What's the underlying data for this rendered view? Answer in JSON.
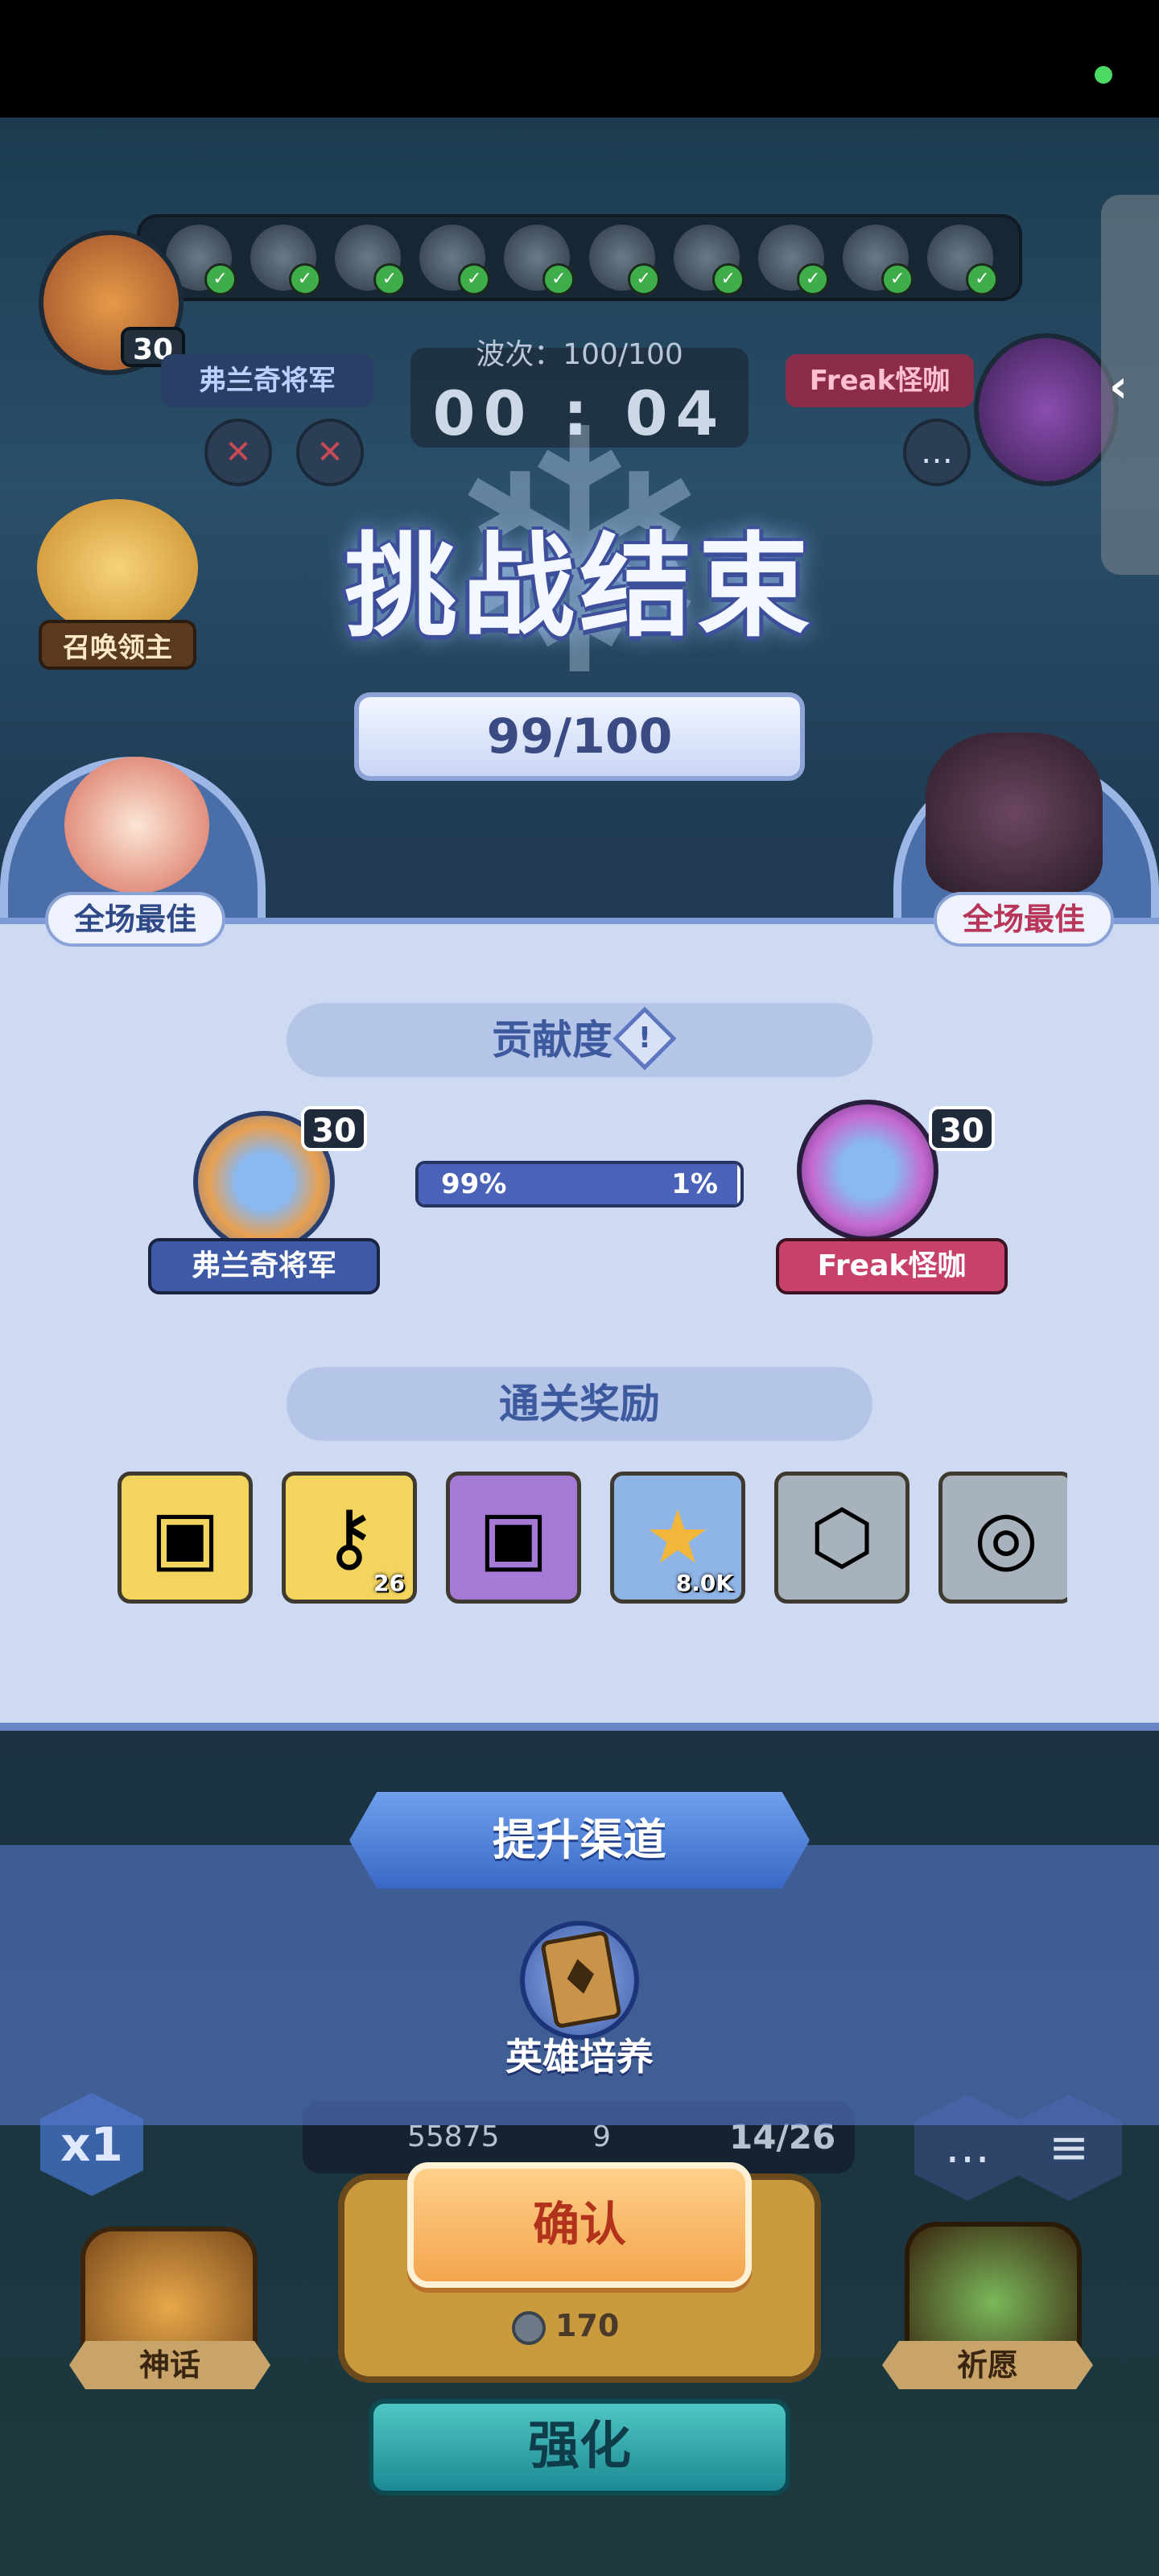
{
  "hud": {
    "left_player_name": "弗兰奇将军",
    "left_player_level": "30",
    "right_player_name": "Freak怪咖",
    "right_player_level": "30",
    "wave_text": "波次：100/100",
    "timer": "00 : 04",
    "summon_lord_label": "召唤领主"
  },
  "result": {
    "title": "挑战结束",
    "score": "99/100",
    "mvp_left": "全场最佳",
    "mvp_right": "全场最佳"
  },
  "contribution": {
    "header": "贡献度",
    "info_icon": "!",
    "left_name": "弗兰奇将军",
    "left_level": "30",
    "right_name": "Freak怪咖",
    "right_level": "30",
    "left_pct": "99%",
    "right_pct": "1%",
    "left_fraction": 0.99
  },
  "rewards": {
    "header": "通关奖励",
    "items": [
      {
        "icon": "gold-chest-icon",
        "qty": ""
      },
      {
        "icon": "gold-key-icon",
        "qty": "26"
      },
      {
        "icon": "purple-chest-icon",
        "qty": ""
      },
      {
        "icon": "gold-coin-icon",
        "qty": "8.0K"
      },
      {
        "icon": "hero-emblem-icon",
        "qty": ""
      },
      {
        "icon": "silver-emblem-icon",
        "qty": ""
      }
    ]
  },
  "channel": {
    "banner": "提升渠道",
    "hero_train_label": "英雄培养"
  },
  "bottom": {
    "speed": "x1",
    "resource_1": "55875",
    "resource_2": "9",
    "resource_3": "14/26",
    "confirm_label": "确认",
    "cost": "170",
    "strengthen_label": "强化",
    "myth_label": "神话",
    "pray_label": "祈愿"
  },
  "colors": {
    "panel_bg": "#ced9f2",
    "accent_blue": "#4a62b8",
    "confirm_orange": "#f3a54e",
    "rival_pink": "#c8416a"
  }
}
